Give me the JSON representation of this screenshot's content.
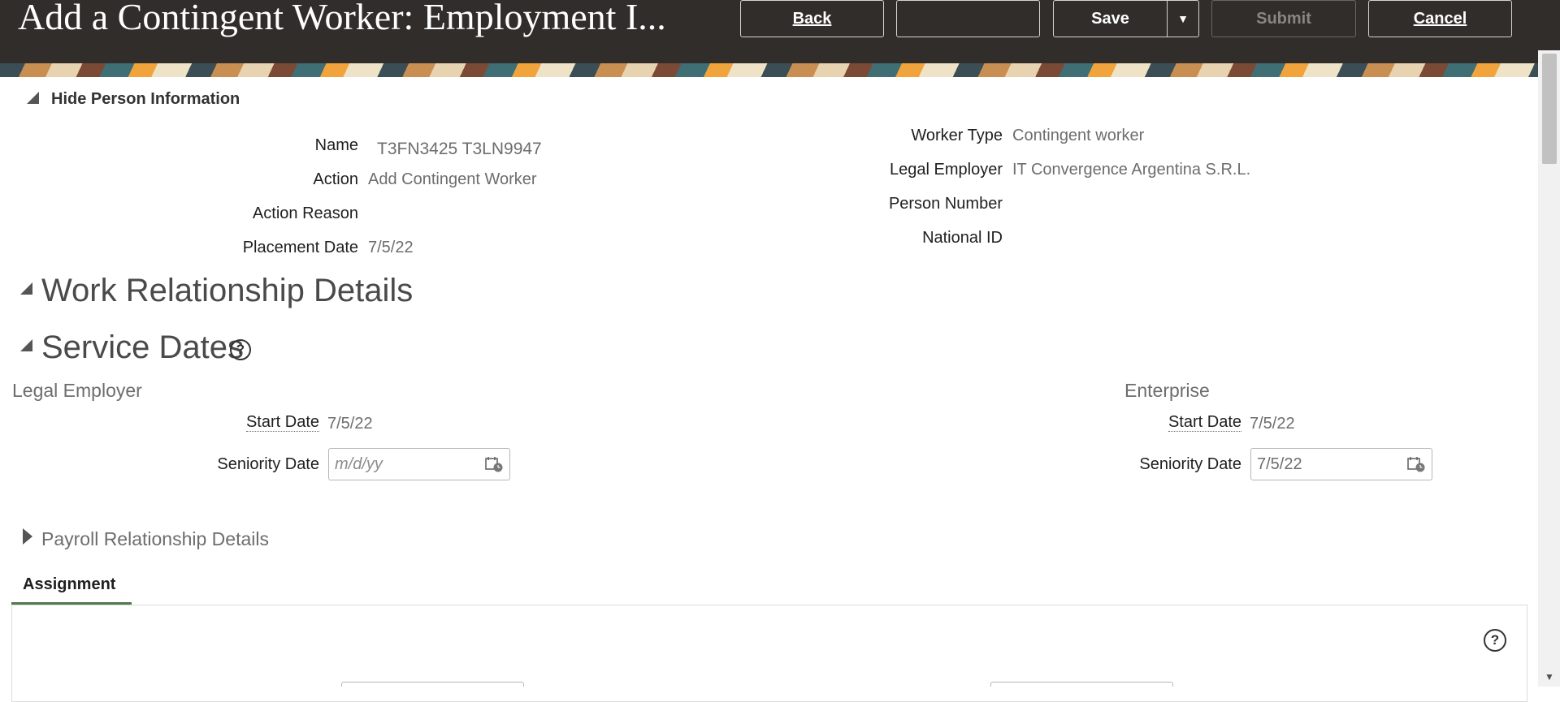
{
  "header": {
    "title": "Add a Contingent Worker: Employment I...",
    "back_label": "Back",
    "blank_label": "",
    "save_label": "Save",
    "submit_label": "Submit",
    "cancel_label": "Cancel"
  },
  "person_info": {
    "toggle_label": "Hide Person Information",
    "left": [
      {
        "label": "Name",
        "value": "T3FN3425 T3LN9947"
      },
      {
        "label": "Action",
        "value": "Add Contingent Worker"
      },
      {
        "label": "Action Reason",
        "value": ""
      },
      {
        "label": "Placement Date",
        "value": "7/5/22"
      }
    ],
    "right": [
      {
        "label": "Worker Type",
        "value": "Contingent worker"
      },
      {
        "label": "Legal Employer",
        "value": "IT Convergence Argentina S.R.L."
      },
      {
        "label": "Person Number",
        "value": ""
      },
      {
        "label": "National ID",
        "value": ""
      }
    ]
  },
  "work_relationship": {
    "title": "Work Relationship Details"
  },
  "service_dates": {
    "title": "Service Dates",
    "legal_employer": {
      "heading": "Legal Employer",
      "start_label": "Start Date",
      "start_value": "7/5/22",
      "seniority_label": "Seniority Date",
      "seniority_placeholder": "m/d/yy"
    },
    "enterprise": {
      "heading": "Enterprise",
      "start_label": "Start Date",
      "start_value": "7/5/22",
      "seniority_label": "Seniority Date",
      "seniority_value": "7/5/22"
    }
  },
  "payroll": {
    "title": "Payroll Relationship Details"
  },
  "tabs": {
    "assignment": "Assignment"
  }
}
